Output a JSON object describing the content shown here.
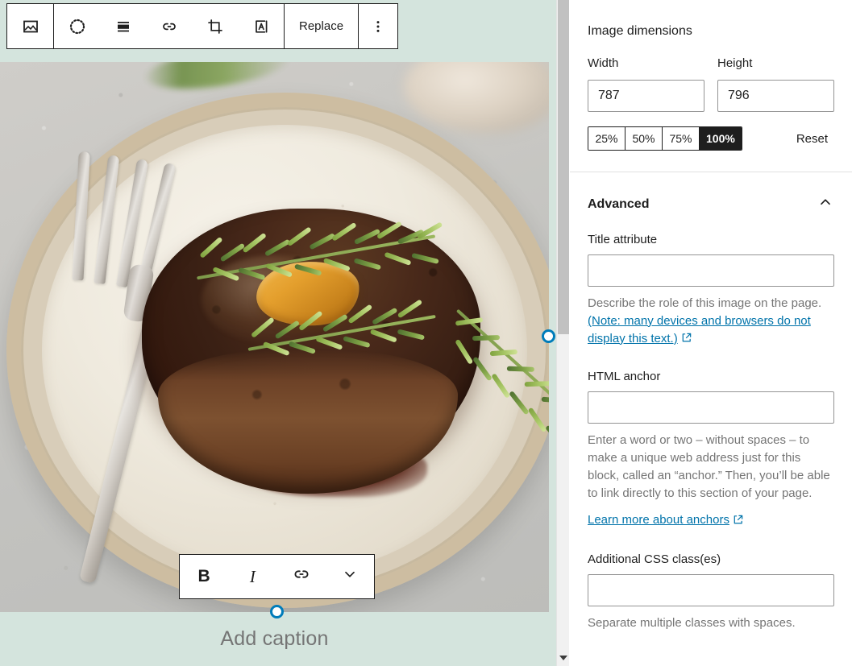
{
  "block_toolbar": {
    "buttons": [
      {
        "name": "image-block-icon",
        "label": "Image",
        "icon": "image-icon"
      },
      {
        "name": "drag-handle",
        "label": "Drag",
        "icon": "dotted-circle-icon"
      },
      {
        "name": "align-button",
        "label": "Align",
        "icon": "align-full-icon"
      },
      {
        "name": "link-button",
        "label": "Link",
        "icon": "link-icon"
      },
      {
        "name": "crop-button",
        "label": "Crop",
        "icon": "crop-icon"
      },
      {
        "name": "text-over-image-button",
        "label": "Add text over image",
        "icon": "text-box-icon"
      }
    ],
    "replace_label": "Replace",
    "more_options_icon": "more-vertical-icon"
  },
  "format_toolbar": {
    "bold_label": "B",
    "italic_label": "I",
    "link_icon": "link-icon",
    "more_icon": "chevron-down-icon"
  },
  "caption": {
    "placeholder": "Add caption"
  },
  "image": {
    "alt_description": "Seared filet mignon steak topped with rosemary sprigs and a pat of butter on a speckled ceramic plate with a silver fork",
    "resize_handles": [
      "right",
      "bottom"
    ]
  },
  "sidebar": {
    "dimensions": {
      "title": "Image dimensions",
      "width_label": "Width",
      "width_value": "787",
      "height_label": "Height",
      "height_value": "796",
      "scale_options": [
        "25%",
        "50%",
        "75%",
        "100%"
      ],
      "scale_selected": "100%",
      "reset_label": "Reset"
    },
    "advanced": {
      "title": "Advanced",
      "collapse_icon": "chevron-up-icon",
      "title_attribute": {
        "label": "Title attribute",
        "value": "",
        "help_plain": "Describe the role of this image on the page.",
        "help_link": "(Note: many devices and browsers do not display this text.)",
        "external_icon": "external-link-icon"
      },
      "html_anchor": {
        "label": "HTML anchor",
        "value": "",
        "help": "Enter a word or two – without spaces – to make a unique web address just for this block, called an “anchor.” Then, you’ll be able to link directly to this section of your page.",
        "learn_more": "Learn more about anchors",
        "external_icon": "external-link-icon"
      },
      "css_classes": {
        "label": "Additional CSS class(es)",
        "value": "",
        "help": "Separate multiple classes with spaces."
      }
    }
  },
  "colors": {
    "canvas_background": "#d4e4dd",
    "accent": "#007cba",
    "link": "#0073aa",
    "muted_text": "#757575",
    "primary_text": "#1e1e1e"
  }
}
